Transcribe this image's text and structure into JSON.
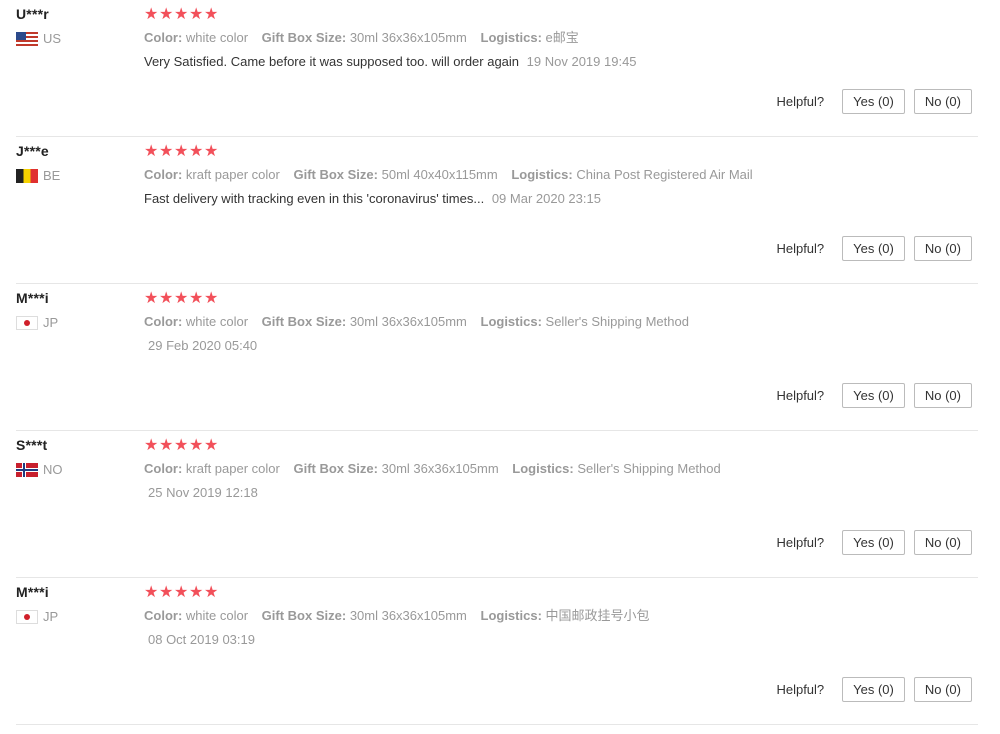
{
  "labels": {
    "color": "Color:",
    "gift_box_size": "Gift Box Size:",
    "logistics": "Logistics:",
    "helpful": "Helpful?",
    "yes": "Yes (0)",
    "no": "No (0)",
    "star_glyph": "★"
  },
  "colors": {
    "star": "#f2505a",
    "muted": "#999999"
  },
  "reviews": [
    {
      "user": "U***r",
      "country": "US",
      "flag_icon": "us-flag-icon",
      "rating": 5,
      "color": "white color",
      "gift_box_size": "30ml 36x36x105mm",
      "logistics": "e邮宝",
      "feedback": "Very Satisfied. Came before it was supposed too. will order again",
      "date": "19 Nov 2019 19:45"
    },
    {
      "user": "J***e",
      "country": "BE",
      "flag_icon": "be-flag-icon",
      "rating": 5,
      "color": "kraft paper color",
      "gift_box_size": "50ml 40x40x115mm",
      "logistics": "China Post Registered Air Mail",
      "feedback": "Fast delivery with tracking even in this 'coronavirus' times...",
      "date": "09 Mar 2020 23:15"
    },
    {
      "user": "M***i",
      "country": "JP",
      "flag_icon": "jp-flag-icon",
      "rating": 5,
      "color": "white color",
      "gift_box_size": "30ml 36x36x105mm",
      "logistics": "Seller's Shipping Method",
      "feedback": "",
      "date": "29 Feb 2020 05:40"
    },
    {
      "user": "S***t",
      "country": "NO",
      "flag_icon": "no-flag-icon",
      "rating": 5,
      "color": "kraft paper color",
      "gift_box_size": "30ml 36x36x105mm",
      "logistics": "Seller's Shipping Method",
      "feedback": "",
      "date": "25 Nov 2019 12:18"
    },
    {
      "user": "M***i",
      "country": "JP",
      "flag_icon": "jp-flag-icon",
      "rating": 5,
      "color": "white color",
      "gift_box_size": "30ml 36x36x105mm",
      "logistics": "中国邮政挂号小包",
      "feedback": "",
      "date": "08 Oct 2019 03:19"
    }
  ]
}
